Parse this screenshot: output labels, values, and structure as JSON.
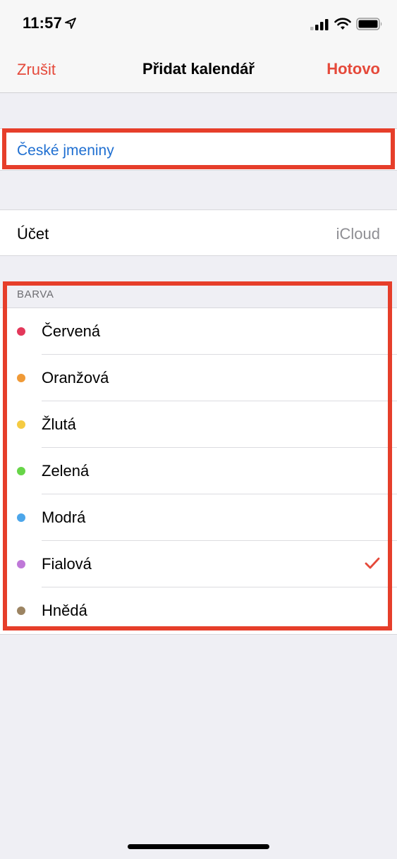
{
  "status_bar": {
    "time": "11:57",
    "icons": [
      "location-arrow-icon",
      "cellular-signal-icon",
      "wifi-icon",
      "battery-icon"
    ]
  },
  "nav": {
    "cancel_label": "Zrušit",
    "title": "Přidat kalendář",
    "done_label": "Hotovo"
  },
  "calendar_name": {
    "value": "České jmeniny"
  },
  "account": {
    "label": "Účet",
    "value": "iCloud"
  },
  "color_section": {
    "header": "BARVA",
    "selected": "Fialová",
    "items": [
      {
        "label": "Červená",
        "color": "#e3385a"
      },
      {
        "label": "Oranžová",
        "color": "#f09a37"
      },
      {
        "label": "Žlutá",
        "color": "#f5cb42"
      },
      {
        "label": "Zelená",
        "color": "#67d548"
      },
      {
        "label": "Modrá",
        "color": "#4ca6ea"
      },
      {
        "label": "Fialová",
        "color": "#bf78d8"
      },
      {
        "label": "Hnědá",
        "color": "#9c8462"
      }
    ]
  },
  "accent_color": "#e5493a",
  "highlight_color": "#e63e2a",
  "link_color": "#1f6fd1"
}
